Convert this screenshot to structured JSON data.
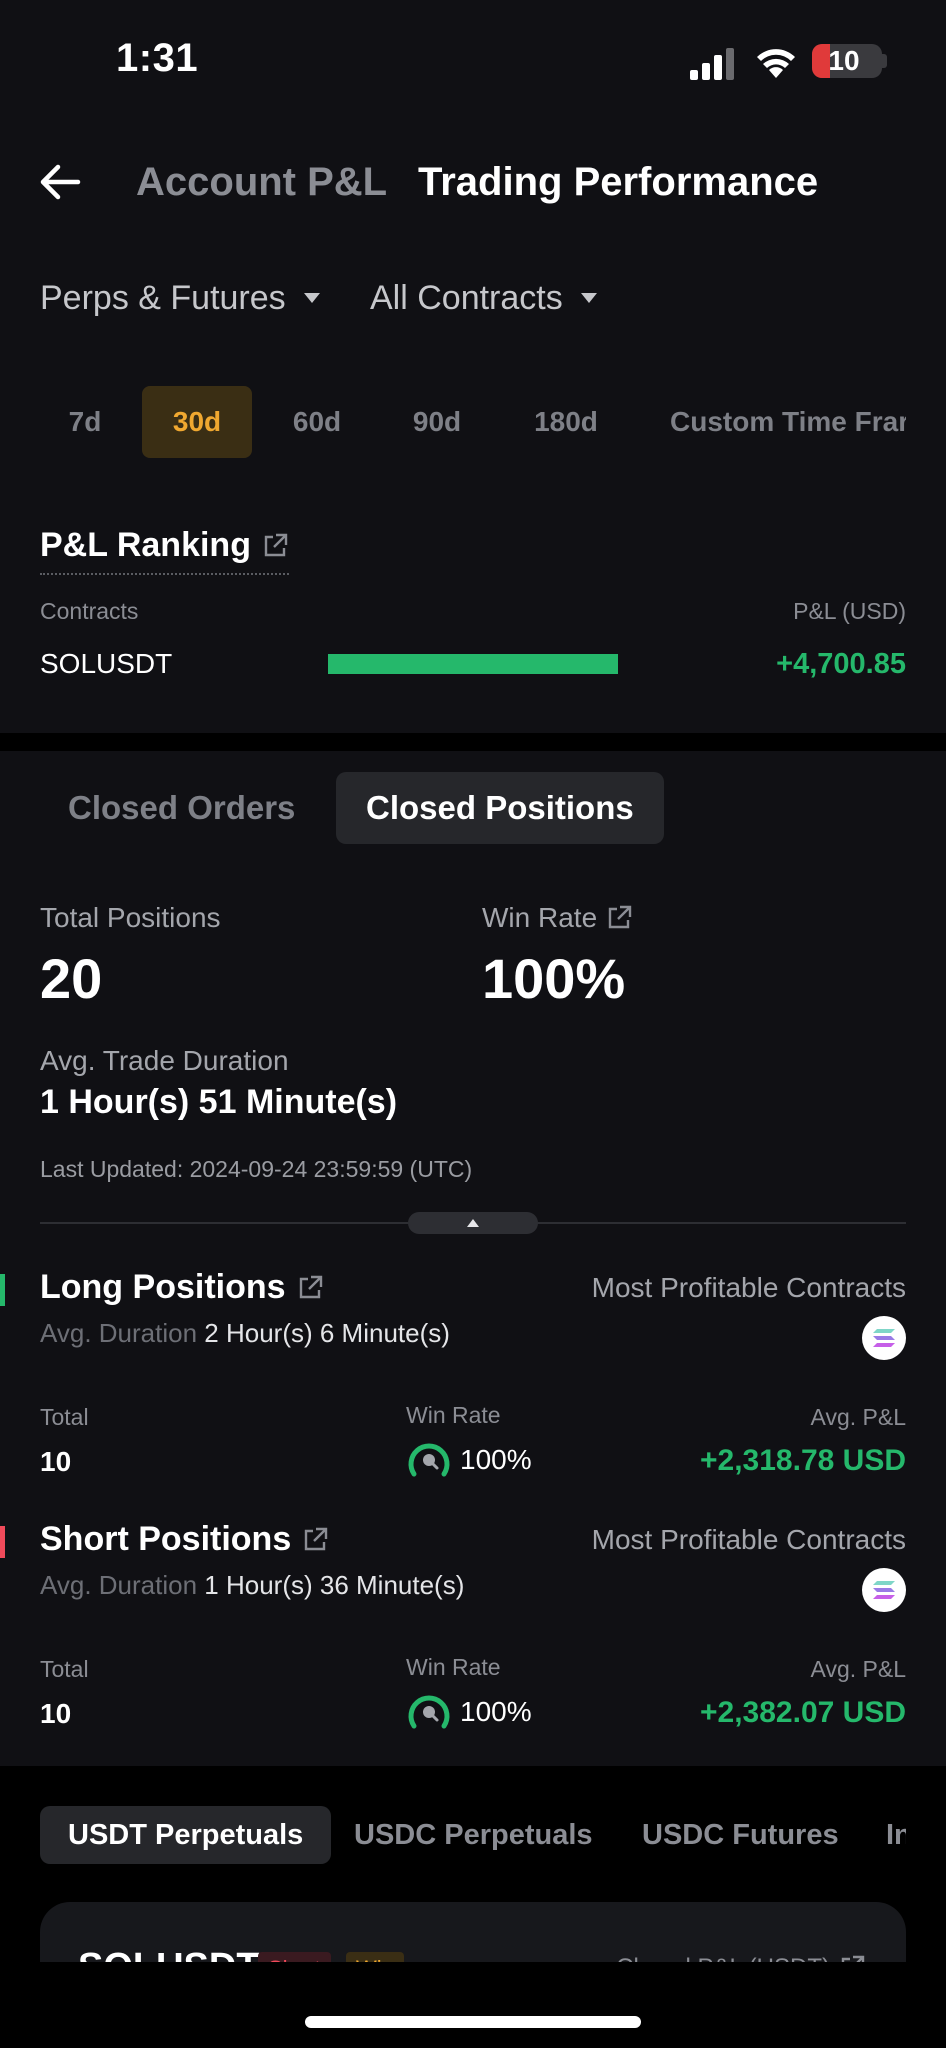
{
  "status_bar": {
    "time": "1:31",
    "battery": "10"
  },
  "header": {
    "tabs": [
      "Account P&L",
      "Trading Performance"
    ],
    "active_tab": "Trading Performance"
  },
  "filters": {
    "product": "Perps & Futures",
    "contracts": "All Contracts"
  },
  "periods": [
    "7d",
    "30d",
    "60d",
    "90d",
    "180d",
    "Custom Time Frar"
  ],
  "active_period": "30d",
  "ranking": {
    "title": "P&L Ranking",
    "col_left": "Contracts",
    "col_right": "P&L (USD)",
    "rows": [
      {
        "contract": "SOLUSDT",
        "pnl": "+4,700.85",
        "bar_fraction": 1.0
      }
    ]
  },
  "closed_tabs": {
    "orders": "Closed Orders",
    "positions": "Closed Positions"
  },
  "summary": {
    "total_label": "Total Positions",
    "total_value": "20",
    "winrate_label": "Win Rate",
    "winrate_value": "100%",
    "duration_label": "Avg. Trade Duration",
    "duration_value": "1 Hour(s) 51 Minute(s)",
    "last_updated": "Last Updated: 2024-09-24 23:59:59 (UTC)"
  },
  "long": {
    "title": "Long Positions",
    "most_profitable": "Most Profitable Contracts",
    "avg_duration_label": "Avg. Duration",
    "avg_duration_value": "2 Hour(s) 6 Minute(s)",
    "total_label": "Total",
    "total_value": "10",
    "winrate_label": "Win Rate",
    "winrate_value": "100%",
    "winrate_fraction": 1.0,
    "avg_pnl_label": "Avg. P&L",
    "avg_pnl_value": "+2,318.78 USD"
  },
  "short": {
    "title": "Short Positions",
    "most_profitable": "Most Profitable Contracts",
    "avg_duration_label": "Avg. Duration",
    "avg_duration_value": "1 Hour(s) 36 Minute(s)",
    "total_label": "Total",
    "total_value": "10",
    "winrate_label": "Win Rate",
    "winrate_value": "100%",
    "winrate_fraction": 1.0,
    "avg_pnl_label": "Avg. P&L",
    "avg_pnl_value": "+2,382.07 USD"
  },
  "market_tabs": [
    "USDT Perpetuals",
    "USDC Perpetuals",
    "USDC Futures",
    "In"
  ],
  "active_market_tab": "USDT Perpetuals",
  "card": {
    "symbol": "SOLUSDT",
    "side_tag": "Short",
    "result_tag": "Win",
    "pnl_label": "Closed P&L (USDT)"
  },
  "colors": {
    "background": "#101014",
    "profit_green": "#25b86b",
    "loss_red": "#f04a5a",
    "accent_orange": "#f0a830"
  }
}
